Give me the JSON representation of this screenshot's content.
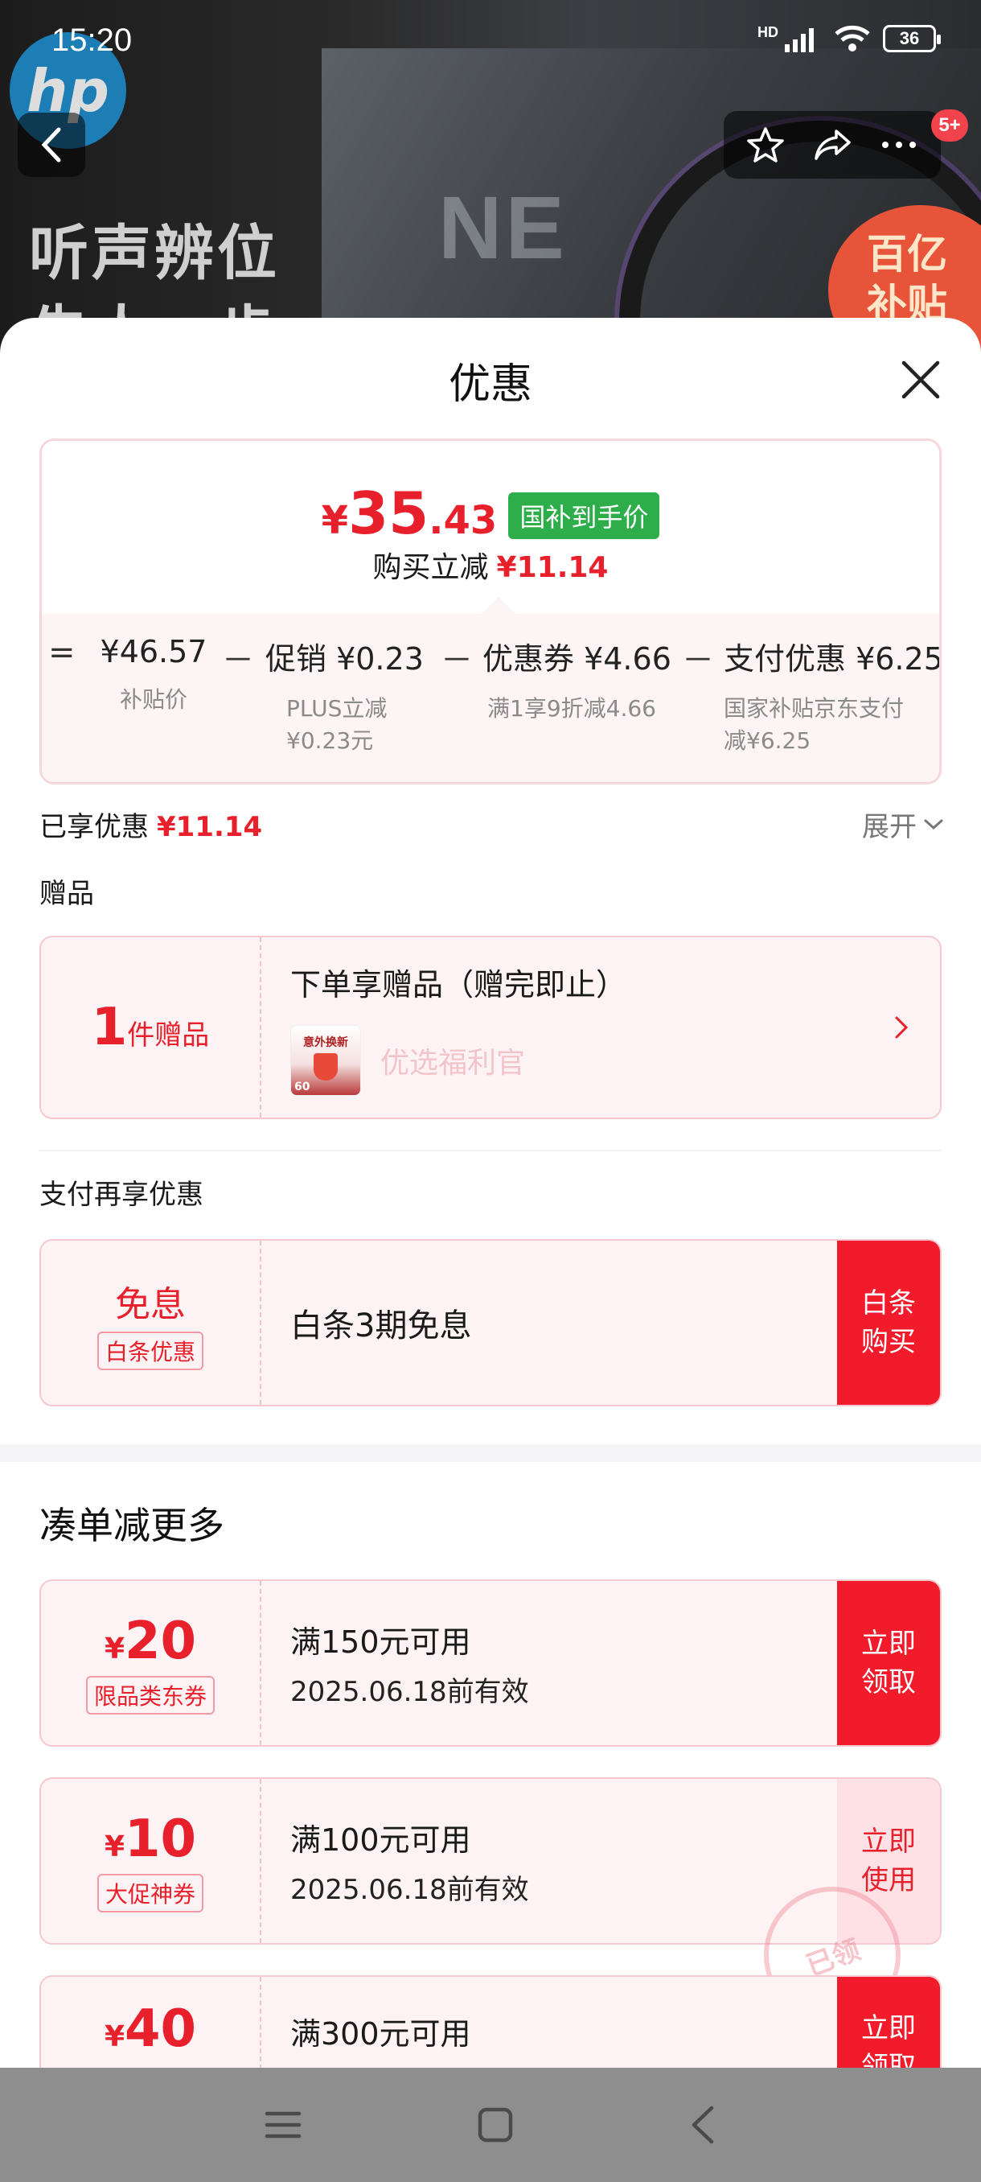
{
  "status_bar": {
    "time": "15:20",
    "network": "HD",
    "battery": "36"
  },
  "background": {
    "logo": "hp",
    "brand_text": "NE",
    "headline_line1": "听声辨位",
    "headline_line2": "先人一步",
    "subsidy_badge_line1": "百亿",
    "subsidy_badge_line2": "补贴",
    "notification_badge": "5+"
  },
  "sheet": {
    "title": "优惠",
    "price_card": {
      "currency": "¥",
      "price_int": "35",
      "price_dec": ".43",
      "price_tag": "国补到手价",
      "instant_label": "购买立减",
      "instant_value": "¥11.14",
      "breakdown": [
        {
          "op": "=",
          "value": "¥46.57",
          "desc": "补贴价"
        },
        {
          "op": "－",
          "value": "促销 ¥0.23",
          "desc": "PLUS立减 ¥0.23元"
        },
        {
          "op": "－",
          "value": "优惠券 ¥4.66",
          "desc": "满1享9折减4.66"
        },
        {
          "op": "－",
          "value": "支付优惠 ¥6.25",
          "desc": "国家补贴京东支付 减¥6.25"
        }
      ]
    },
    "enjoyed_label": "已享优惠",
    "enjoyed_value": "¥11.14",
    "expand_label": "展开",
    "gift_section": {
      "label": "赠品",
      "count": "1",
      "count_unit": "件赠品",
      "title": "下单享赠品（赠完即止）",
      "thumb_text": "意外换新",
      "thumb_badge": "60",
      "gift_name": "优选福利官"
    },
    "pay_section": {
      "label": "支付再享优惠",
      "left_title": "免息",
      "left_tag": "白条优惠",
      "title": "白条3期免息",
      "cta": "白条购买"
    },
    "more_section": {
      "heading": "凑单减更多",
      "coupons": [
        {
          "currency": "¥",
          "amount": "20",
          "tag": "限品类东券",
          "title": "满150元可用",
          "validity": "2025.06.18前有效",
          "cta": "立即领取",
          "claimed": false
        },
        {
          "currency": "¥",
          "amount": "10",
          "tag": "大促神券",
          "title": "满100元可用",
          "validity": "2025.06.18前有效",
          "cta": "立即使用",
          "claimed": true
        },
        {
          "currency": "¥",
          "amount": "40",
          "tag": "",
          "title": "满300元可用",
          "validity": "",
          "cta": "立即领取",
          "claimed": false
        }
      ],
      "claimed_stamp": "已领"
    }
  }
}
